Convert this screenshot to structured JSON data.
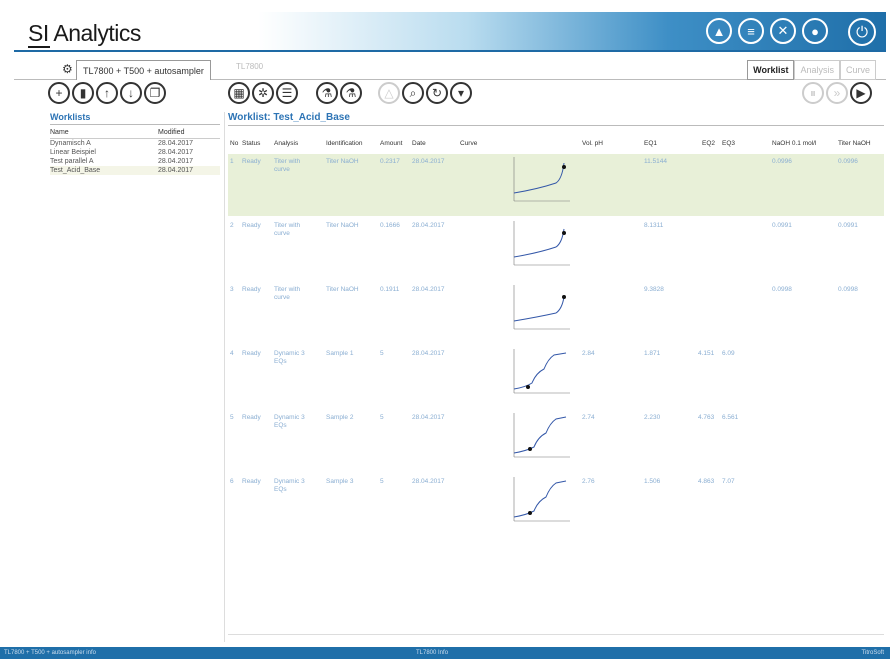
{
  "header": {
    "brand": "SI Analytics",
    "icons": [
      "warning-icon",
      "database-icon",
      "tools-icon",
      "user-icon"
    ],
    "power_icon": "power-icon"
  },
  "tabs": {
    "main_tab": "TL7800 + T500 + autosampler",
    "inactive_tab": "TL7800",
    "views": [
      "Worklist",
      "Analysis",
      "Curve"
    ]
  },
  "left": {
    "title": "Worklists",
    "col_name": "Name",
    "col_modified": "Modified",
    "rows": [
      {
        "name": "Dynamisch A",
        "modified": "28.04.2017"
      },
      {
        "name": "Linear Beispiel",
        "modified": "28.04.2017"
      },
      {
        "name": "Test parallel A",
        "modified": "28.04.2017"
      },
      {
        "name": "Test_Acid_Base",
        "modified": "28.04.2017"
      }
    ]
  },
  "right": {
    "title": "Worklist: Test_Acid_Base",
    "columns": [
      "No",
      "Status",
      "Analysis",
      "Identification",
      "Amount",
      "Date",
      "Curve",
      "Vol. pH",
      "EQ1",
      "EQ2",
      "EQ3",
      "NaOH 0.1 mol/l",
      "Titer NaOH"
    ],
    "rows": [
      {
        "no": "1",
        "status": "Ready",
        "analysis": "Titer with curve",
        "ident": "Titer NaOH",
        "amount": "0.2317",
        "date": "28.04.2017",
        "ph": "",
        "eq1": "11.5144",
        "eq2": "",
        "eq3": "",
        "naoh": "0.0996",
        "titer": "0.0996"
      },
      {
        "no": "2",
        "status": "Ready",
        "analysis": "Titer with curve",
        "ident": "Titer NaOH",
        "amount": "0.1666",
        "date": "28.04.2017",
        "ph": "",
        "eq1": "8.1311",
        "eq2": "",
        "eq3": "",
        "naoh": "0.0991",
        "titer": "0.0991"
      },
      {
        "no": "3",
        "status": "Ready",
        "analysis": "Titer with curve",
        "ident": "Titer NaOH",
        "amount": "0.1911",
        "date": "28.04.2017",
        "ph": "",
        "eq1": "9.3828",
        "eq2": "",
        "eq3": "",
        "naoh": "0.0998",
        "titer": "0.0998"
      },
      {
        "no": "4",
        "status": "Ready",
        "analysis": "Dynamic 3 EQs",
        "ident": "Sample 1",
        "amount": "5",
        "date": "28.04.2017",
        "ph": "2.84",
        "eq1": "1.871",
        "eq2": "4.151",
        "eq3": "6.09",
        "naoh": "",
        "titer": ""
      },
      {
        "no": "5",
        "status": "Ready",
        "analysis": "Dynamic 3 EQs",
        "ident": "Sample 2",
        "amount": "5",
        "date": "28.04.2017",
        "ph": "2.74",
        "eq1": "2.230",
        "eq2": "4.763",
        "eq3": "6.561",
        "naoh": "",
        "titer": ""
      },
      {
        "no": "6",
        "status": "Ready",
        "analysis": "Dynamic 3 EQs",
        "ident": "Sample 3",
        "amount": "5",
        "date": "28.04.2017",
        "ph": "2.76",
        "eq1": "1.506",
        "eq2": "4.863",
        "eq3": "7.07",
        "naoh": "",
        "titer": ""
      }
    ]
  },
  "status": {
    "left": "TL7800 + T500 + autosampler info",
    "center": "TL7800 Info",
    "right": "TitroSoft"
  }
}
